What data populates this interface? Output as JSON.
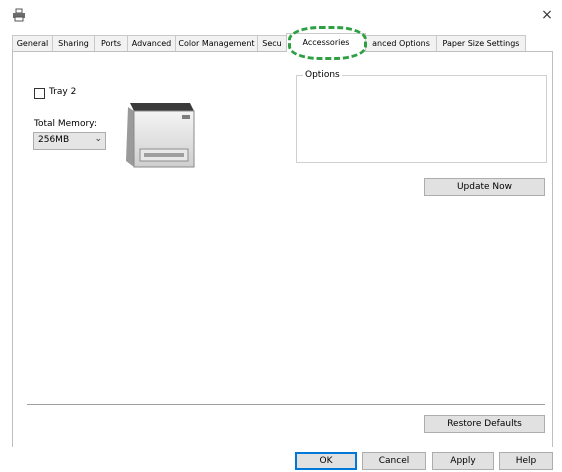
{
  "window": {
    "close_glyph": "×"
  },
  "tabs": [
    {
      "label": "General"
    },
    {
      "label": "Sharing"
    },
    {
      "label": "Ports"
    },
    {
      "label": "Advanced"
    },
    {
      "label": "Color Management"
    },
    {
      "label": "Secu"
    },
    {
      "label": "Accessories",
      "active": true
    },
    {
      "label": "anced Options"
    },
    {
      "label": "Paper Size Settings"
    }
  ],
  "options": {
    "group_label": "Options",
    "tray2_label": "Tray 2",
    "tray2_checked": false,
    "memory_label": "Total Memory:",
    "memory_value": "256MB"
  },
  "buttons": {
    "update_now": "Update Now",
    "restore_defaults": "Restore Defaults",
    "ok": "OK",
    "cancel": "Cancel",
    "apply": "Apply",
    "help": "Help"
  },
  "colors": {
    "highlight": "#2ea043",
    "panel_border": "#bfbfbf",
    "button_bg": "#e1e1e1"
  }
}
